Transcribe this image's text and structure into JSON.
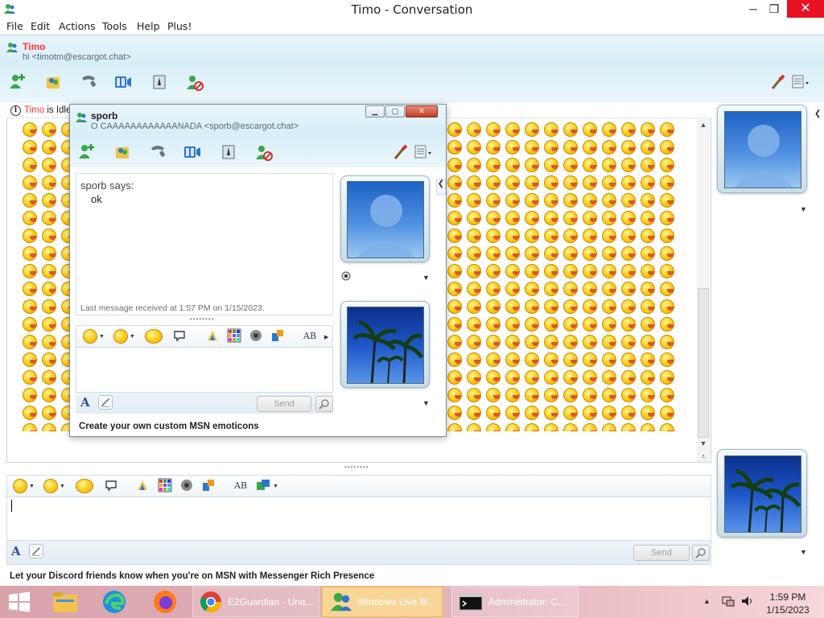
{
  "window": {
    "title": "Timo - Conversation",
    "minimize": "─",
    "maximize": "❐",
    "close": "✕"
  },
  "menu": [
    "File",
    "Edit",
    "Actions",
    "Tools",
    "Help",
    "Plus!"
  ],
  "contact": {
    "name": "Timo",
    "status_line": "hi <timotm@escargot.chat>"
  },
  "info_bar": {
    "name": "Timo",
    "text": " is Idle"
  },
  "popup": {
    "name": "sporb",
    "status_line": "O CAAAAAAAAAAAANADA <sporb@escargot.chat>",
    "says": "sporb says:",
    "message": "ok",
    "last_message": "Last message received at 1:57 PM on 1/15/2023.",
    "send_label": "Send",
    "footer": "Create your own custom MSN emoticons"
  },
  "main_input": {
    "send_label": "Send"
  },
  "ad_text": "Let your Discord friends know when you're on MSN with Messenger Rich Presence",
  "taskbar": {
    "items": [
      {
        "label": "E2Guardian - Una..."
      },
      {
        "label": "Windows Live M..."
      },
      {
        "label": "Administrator:  C..."
      }
    ],
    "time": "1:59 PM",
    "date": "1/15/2023"
  },
  "colors": {
    "contact_name": "#ff3131",
    "header_gradient_top": "#e9f5fa",
    "close_button": "#e81123",
    "taskbar": "#d9a3ac"
  },
  "icons": {
    "app": "msn-buddy-icon",
    "info": "info-icon",
    "emoticon": "tongue-out-smiley-icon"
  }
}
